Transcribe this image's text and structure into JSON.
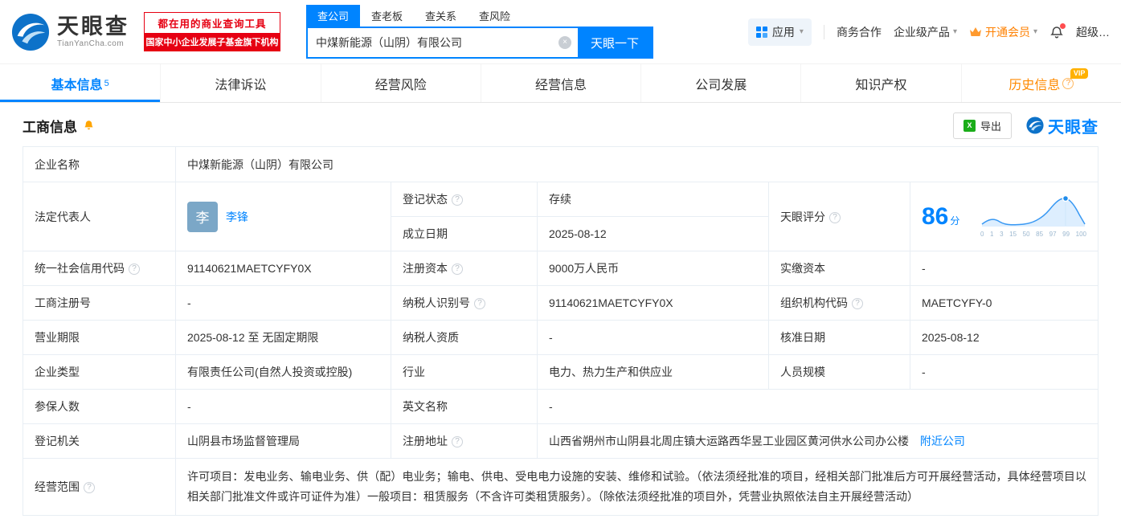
{
  "colors": {
    "accent": "#0084ff",
    "orange": "#ff8000",
    "green": "#00a246",
    "red": "#e60012"
  },
  "icons": {
    "help": "?",
    "clear": "×",
    "caret": "▾",
    "excel": "X"
  },
  "header": {
    "logo": {
      "title": "天眼查",
      "subtitle": "TianYanCha.com"
    },
    "banner": {
      "line1": "都在用的商业查询工具",
      "line2": "国家中小企业发展子基金旗下机构"
    },
    "search": {
      "tabs": [
        {
          "label": "查公司"
        },
        {
          "label": "查老板"
        },
        {
          "label": "查关系"
        },
        {
          "label": "查风险"
        }
      ],
      "value": "中煤新能源（山阴）有限公司",
      "button": "天眼一下"
    },
    "menu": {
      "apps": "应用",
      "business": "商务合作",
      "enterprise": "企业级产品",
      "vip": "开通会员",
      "super": "超级…"
    }
  },
  "nav": {
    "tabs": [
      {
        "label": "基本信息",
        "count": "5"
      },
      {
        "label": "法律诉讼"
      },
      {
        "label": "经营风险"
      },
      {
        "label": "经营信息"
      },
      {
        "label": "公司发展"
      },
      {
        "label": "知识产权"
      },
      {
        "label": "历史信息",
        "badge": "VIP"
      }
    ]
  },
  "section": {
    "title": "工商信息",
    "export_label": "导出",
    "brand": "天眼查"
  },
  "table": {
    "company_name": {
      "label": "企业名称",
      "value": "中煤新能源（山阴）有限公司"
    },
    "legal_rep": {
      "label": "法定代表人",
      "avatar": "李",
      "value": "李锋"
    },
    "reg_status": {
      "label": "登记状态",
      "value": "存续"
    },
    "est_date": {
      "label": "成立日期",
      "value": "2025-08-12"
    },
    "score": {
      "label": "天眼评分"
    },
    "credit_code": {
      "label": "统一社会信用代码",
      "value": "91140621MAETCYFY0X"
    },
    "reg_capital": {
      "label": "注册资本",
      "value": "9000万人民币"
    },
    "paid_capital": {
      "label": "实缴资本",
      "value": "-"
    },
    "reg_number": {
      "label": "工商注册号",
      "value": "-"
    },
    "taxpayer_id": {
      "label": "纳税人识别号",
      "value": "91140621MAETCYFY0X"
    },
    "org_code": {
      "label": "组织机构代码",
      "value": "MAETCYFY-0"
    },
    "business_term": {
      "label": "营业期限",
      "value": "2025-08-12 至 无固定期限"
    },
    "taxpayer_qual": {
      "label": "纳税人资质",
      "value": "-"
    },
    "approval_date": {
      "label": "核准日期",
      "value": "2025-08-12"
    },
    "company_type": {
      "label": "企业类型",
      "value": "有限责任公司(自然人投资或控股)"
    },
    "industry": {
      "label": "行业",
      "value": "电力、热力生产和供应业"
    },
    "staff_size": {
      "label": "人员规模",
      "value": "-"
    },
    "insured_count": {
      "label": "参保人数",
      "value": "-"
    },
    "english_name": {
      "label": "英文名称",
      "value": "-"
    },
    "reg_authority": {
      "label": "登记机关",
      "value": "山阴县市场监督管理局"
    },
    "reg_address": {
      "label": "注册地址",
      "value": "山西省朔州市山阴县北周庄镇大运路西华昱工业园区黄河供水公司办公楼",
      "link": "附近公司"
    },
    "business_scope": {
      "label": "经营范围",
      "value": "许可项目：发电业务、输电业务、供（配）电业务；输电、供电、受电电力设施的安装、维修和试验。（依法须经批准的项目，经相关部门批准后方可开展经营活动，具体经营项目以相关部门批准文件或许可证件为准）一般项目：租赁服务（不含许可类租赁服务）。（除依法须经批准的项目外，凭营业执照依法自主开展经营活动）"
    }
  },
  "score_chart": {
    "type": "line",
    "score": "86",
    "unit": "分",
    "x_labels": [
      "0",
      "1",
      "3",
      "15",
      "50",
      "85",
      "97",
      "99",
      "100"
    ]
  }
}
